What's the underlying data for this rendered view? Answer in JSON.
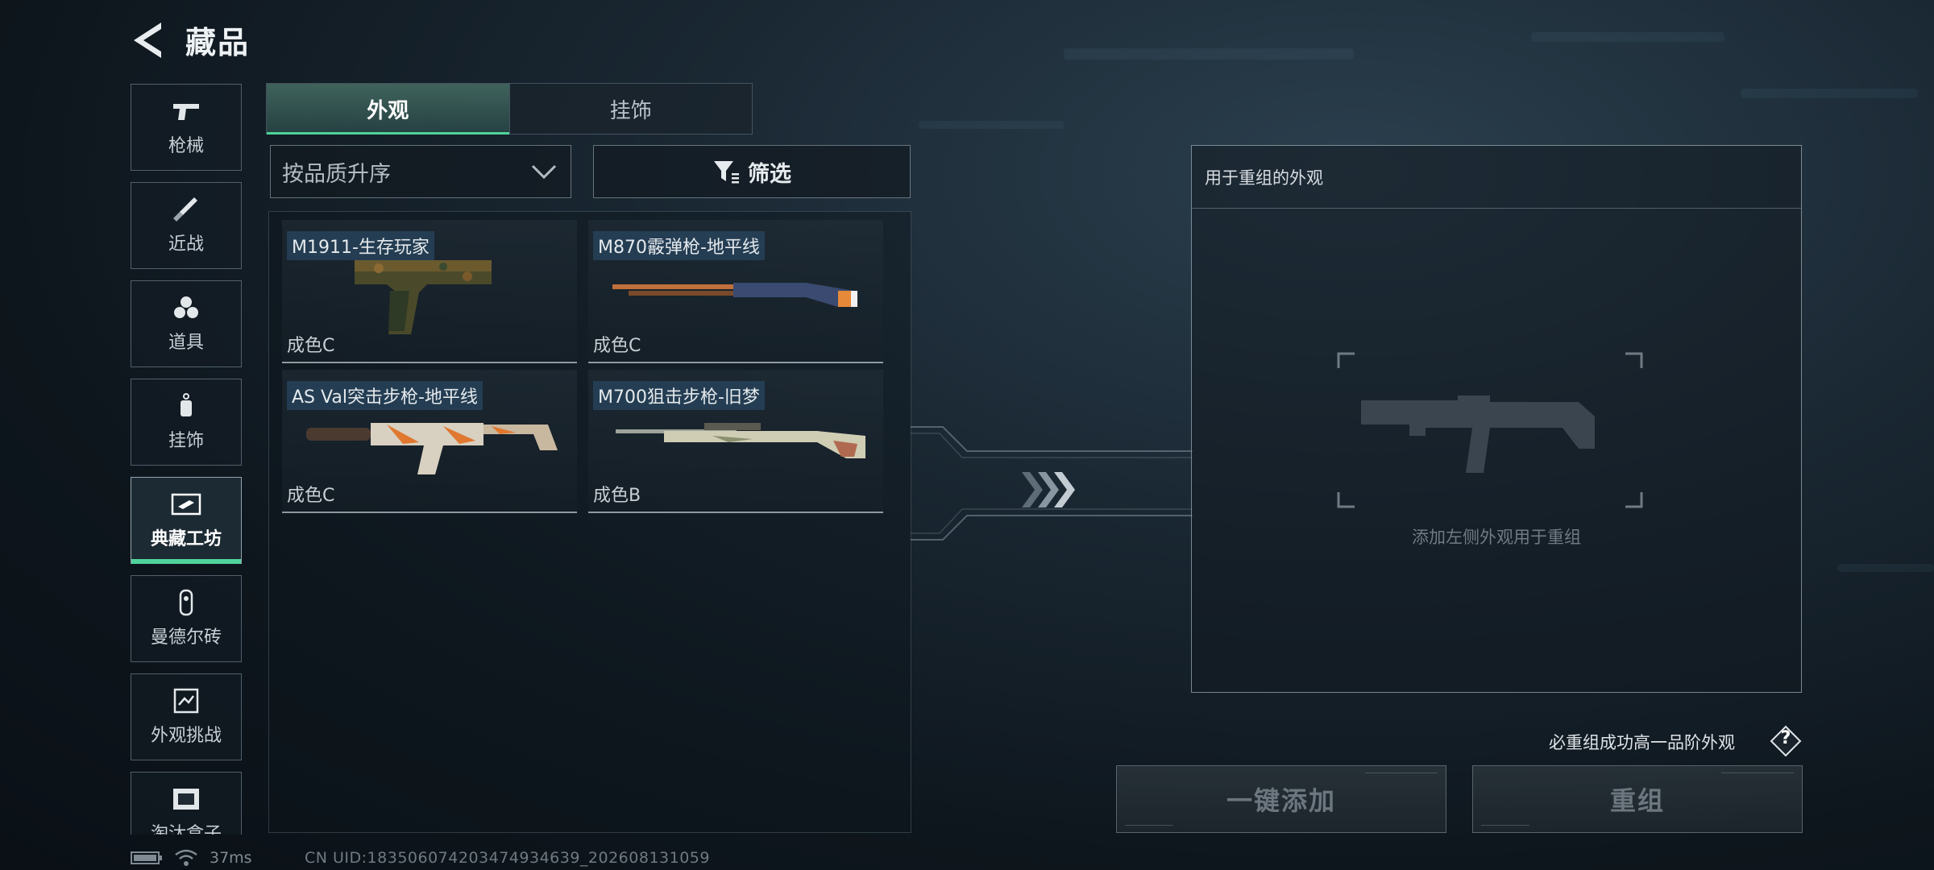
{
  "header": {
    "title": "藏品",
    "back_icon": "back-arrow-icon"
  },
  "categories": [
    {
      "label": "枪械",
      "icon": "pistol-icon"
    },
    {
      "label": "近战",
      "icon": "knife-icon"
    },
    {
      "label": "道具",
      "icon": "grenade-icon"
    },
    {
      "label": "挂饰",
      "icon": "charm-icon"
    },
    {
      "label": "典藏工坊",
      "icon": "workshop-icon",
      "active": true
    },
    {
      "label": "曼德尔砖",
      "icon": "mandel-brick-icon"
    },
    {
      "label": "外观挑战",
      "icon": "challenge-icon"
    },
    {
      "label": "淘汰盒子",
      "icon": "elimination-box-icon"
    }
  ],
  "tabs": [
    {
      "label": "外观",
      "active": true
    },
    {
      "label": "挂饰",
      "active": false
    }
  ],
  "sort": {
    "label": "按品质升序"
  },
  "filter": {
    "label": "筛选"
  },
  "skins": [
    {
      "name": "M1911-生存玩家",
      "grade": "成色C",
      "weapon": "pistol"
    },
    {
      "name": "M870霰弹枪-地平线",
      "grade": "成色C",
      "weapon": "shotgun"
    },
    {
      "name": "AS Val突击步枪-地平线",
      "grade": "成色C",
      "weapon": "assault-rifle"
    },
    {
      "name": "M700狙击步枪-旧梦",
      "grade": "成色B",
      "weapon": "sniper-rifle"
    }
  ],
  "recombine": {
    "title": "用于重组的外观",
    "hint": "添加左侧外观用于重组",
    "guarantee_note": "必重组成功高一品阶外观",
    "help_label": "?"
  },
  "actions": {
    "add_all": "一键添加",
    "recombine": "重组"
  },
  "status": {
    "ping": "37ms",
    "uid": "CN UID:1835060742034749346​39_202608131059"
  },
  "colors": {
    "accent": "#4fd39a",
    "name_tag_bg": "#28465f"
  }
}
